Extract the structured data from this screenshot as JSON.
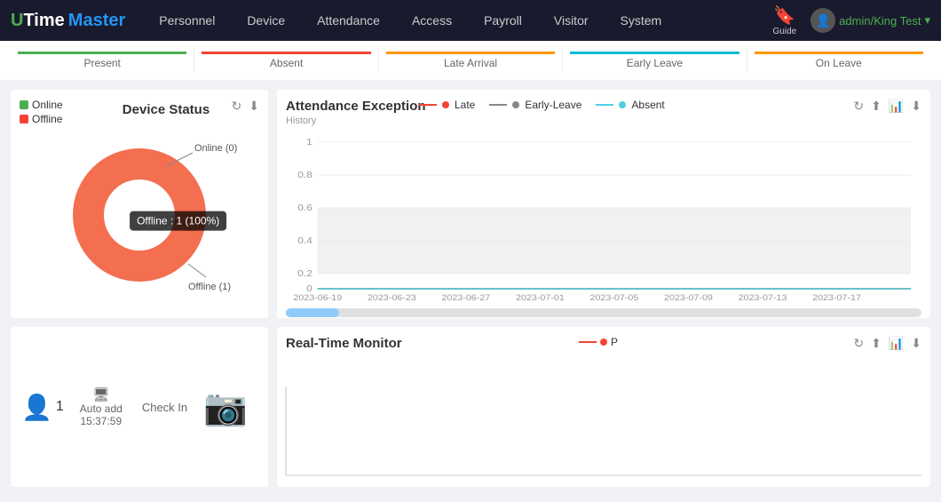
{
  "app": {
    "logo_u": "U",
    "logo_time": "Time",
    "logo_space": " ",
    "logo_master": "Master"
  },
  "nav": {
    "items": [
      {
        "id": "personnel",
        "label": "Personnel"
      },
      {
        "id": "device",
        "label": "Device"
      },
      {
        "id": "attendance",
        "label": "Attendance"
      },
      {
        "id": "access",
        "label": "Access"
      },
      {
        "id": "payroll",
        "label": "Payroll"
      },
      {
        "id": "visitor",
        "label": "Visitor"
      },
      {
        "id": "system",
        "label": "System"
      }
    ],
    "guide_label": "Guide",
    "user": "admin/King Test"
  },
  "summary": {
    "cards": [
      {
        "id": "present",
        "label": "Present",
        "bar_color": "#4caf50"
      },
      {
        "id": "absent",
        "label": "Absent",
        "bar_color": "#f44336"
      },
      {
        "id": "late_arrival",
        "label": "Late Arrival",
        "bar_color": "#ff9800"
      },
      {
        "id": "early_leave",
        "label": "Early Leave",
        "bar_color": "#00bcd4"
      },
      {
        "id": "on_leave",
        "label": "On Leave",
        "bar_color": "#ff9800"
      }
    ]
  },
  "device_status": {
    "title": "Device Status",
    "legend": [
      {
        "id": "online",
        "label": "Online",
        "color": "#4caf50"
      },
      {
        "id": "offline",
        "label": "Offline",
        "color": "#f36f4f"
      }
    ],
    "tooltip": "Offline : 1 (100%)",
    "label_online": "Online (0)",
    "label_offline": "Offline (1)",
    "online_count": 0,
    "offline_count": 1,
    "total": 1,
    "offline_pct": 100,
    "online_pct": 0
  },
  "attendance_exception": {
    "title": "Attendance Exception",
    "history_label": "History",
    "legend": [
      {
        "id": "late",
        "label": "Late",
        "color": "#f44336"
      },
      {
        "id": "early_leave",
        "label": "Early-Leave",
        "color": "#888"
      },
      {
        "id": "absent",
        "label": "Absent",
        "color": "#4dd0e1"
      }
    ],
    "y_axis": [
      "1",
      "0.8",
      "0.6",
      "0.4",
      "0.2",
      "0"
    ],
    "x_labels": [
      "2023-06-19",
      "2023-06-23",
      "2023-06-27",
      "2023-07-01",
      "2023-07-05",
      "2023-07-09",
      "2023-07-13",
      "2023-07-17"
    ],
    "bands": [
      {
        "y_pct": 20,
        "height_pct": 20,
        "color": "#e8e8e8"
      },
      {
        "y_pct": 60,
        "height_pct": 20,
        "color": "#e8e8e8"
      }
    ]
  },
  "realtime_monitor": {
    "title": "Real-Time Monitor",
    "legend": [
      {
        "id": "p",
        "label": "P",
        "color": "#f44336"
      }
    ]
  },
  "checkin": {
    "person_count": "1",
    "auto_add_label": "Auto add",
    "time": "15:37:59",
    "check_in_label": "Check In"
  }
}
